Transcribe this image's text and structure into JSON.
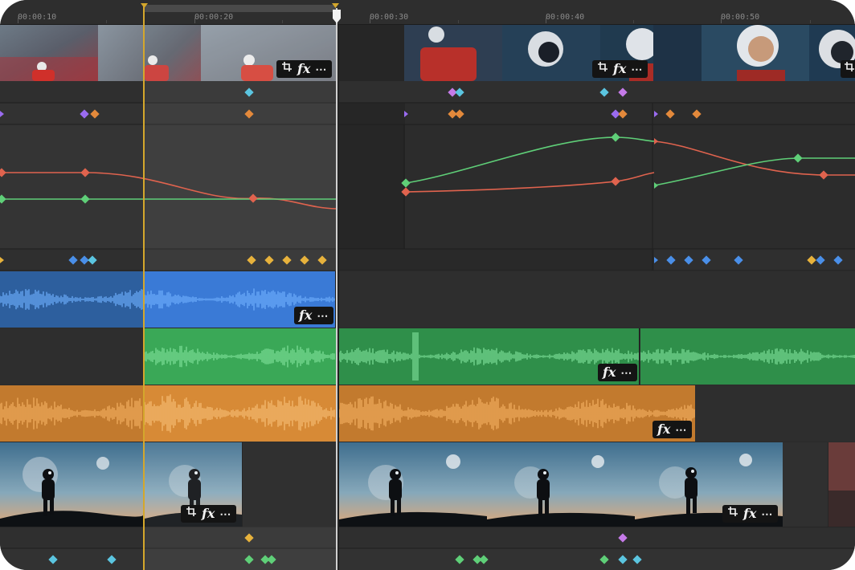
{
  "ruler": {
    "labels": [
      "00:00:10",
      "00:00:20",
      "00:00:30",
      "00:00:40",
      "00:00:50"
    ]
  },
  "clip_badges": {
    "fx_label": "fx",
    "more_label": "⋯"
  },
  "icons": {
    "crop": "crop-icon",
    "fx": "fx-icon",
    "more": "more-icon",
    "keyframe": "diamond-keyframe-icon",
    "playhead": "playhead-handle-icon"
  },
  "colors": {
    "panel_bg": "#2b2b2b",
    "selection": "#d4a72c",
    "audio_blue": "#3a7ad6",
    "audio_green": "#3aa857",
    "audio_orange": "#d78a36",
    "curve_green": "#5fcf78",
    "curve_red": "#e0634e",
    "kf_purple": "#9a6bf0",
    "kf_orange": "#e3893b",
    "kf_cyan": "#5bc5e0",
    "kf_yellow": "#e7b23c",
    "kf_blue": "#4a8fe8",
    "kf_green": "#5fcf78"
  }
}
